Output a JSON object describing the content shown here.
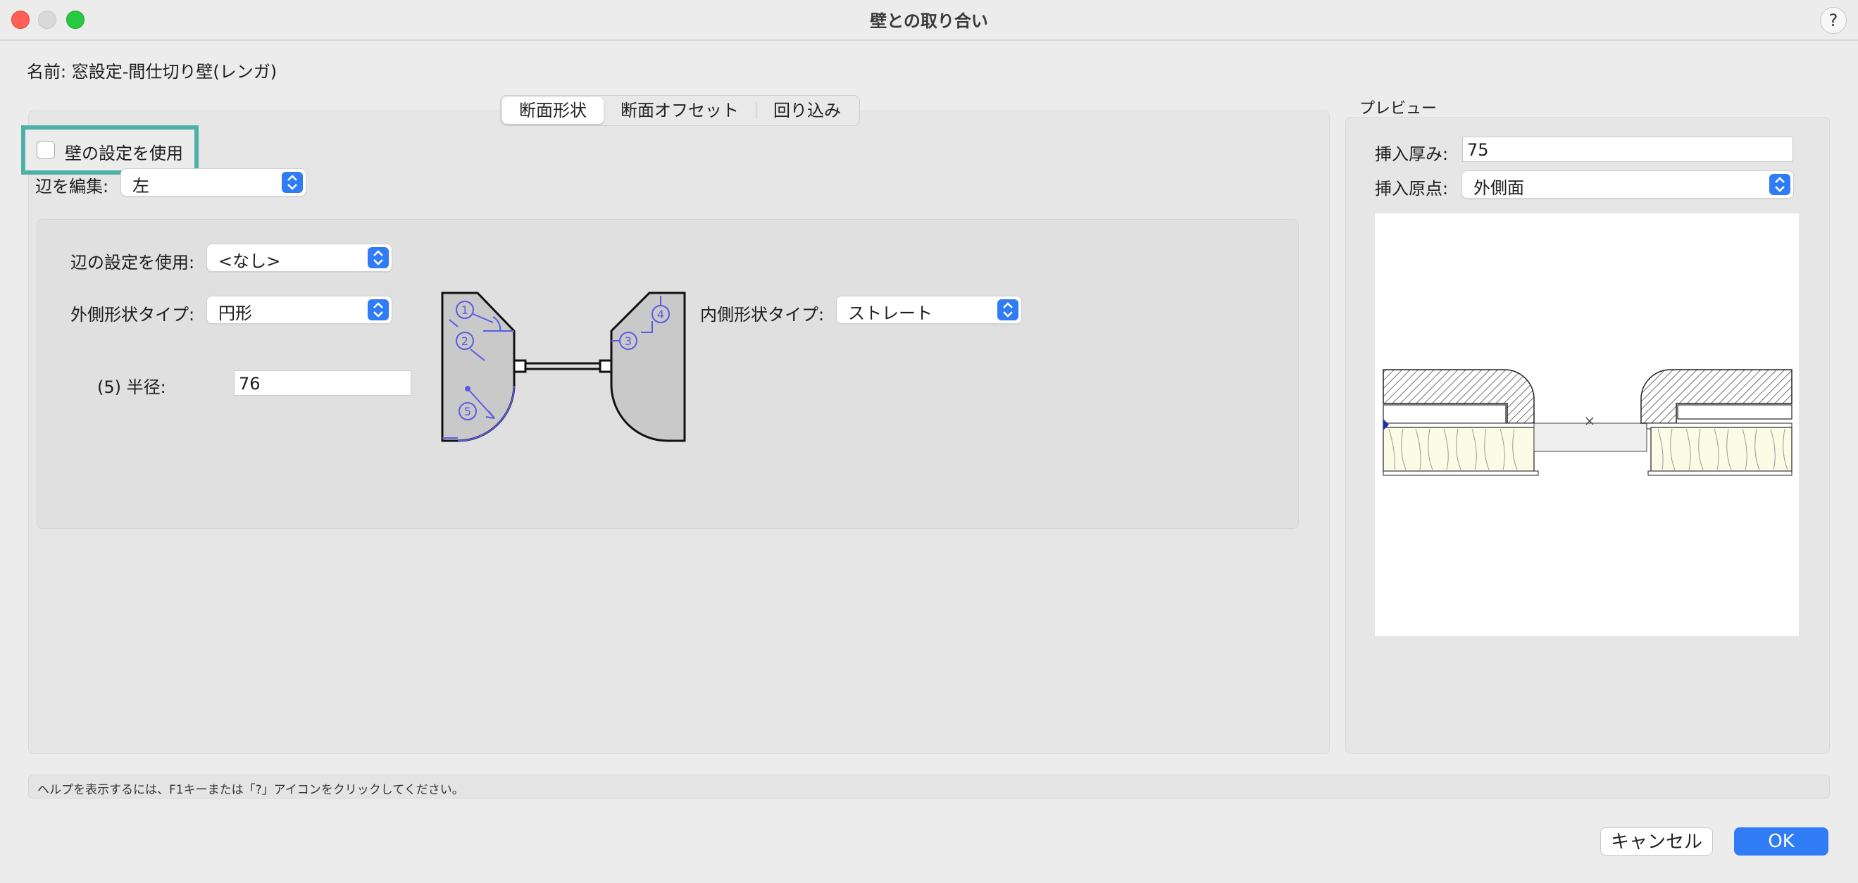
{
  "window": {
    "title": "壁との取り合い",
    "help_label": "?"
  },
  "name_line": "名前:  窓設定-間仕切り壁(レンガ)",
  "tabs": [
    {
      "label": "断面形状",
      "selected": true
    },
    {
      "label": "断面オフセット",
      "selected": false
    },
    {
      "label": "回り込み",
      "selected": false
    }
  ],
  "use_wall_settings": {
    "label": "壁の設定を使用",
    "checked": false
  },
  "edit_side": {
    "label": "辺を編集:",
    "value": "左"
  },
  "side_settings": {
    "label": "辺の設定を使用:",
    "value": "<なし>"
  },
  "outer_shape": {
    "label": "外側形状タイプ:",
    "value": "円形"
  },
  "inner_shape": {
    "label": "内側形状タイプ:",
    "value": "ストレート"
  },
  "radius": {
    "label": "(5) 半径:",
    "value": "76"
  },
  "diagram_labels": [
    "1",
    "2",
    "3",
    "4",
    "5"
  ],
  "preview": {
    "title": "プレビュー",
    "insert_thickness_label": "挿入厚み:",
    "insert_thickness_value": "75",
    "insert_origin_label": "挿入原点:",
    "insert_origin_value": "外側面"
  },
  "status_text": "ヘルプを表示するには、F1キーまたは「?」アイコンをクリックしてください。",
  "buttons": {
    "cancel": "キャンセル",
    "ok": "OK"
  },
  "colors": {
    "accent": "#2f7cf6",
    "highlight": "#4fb0a8",
    "diagram_blue": "#5a5ae6"
  }
}
